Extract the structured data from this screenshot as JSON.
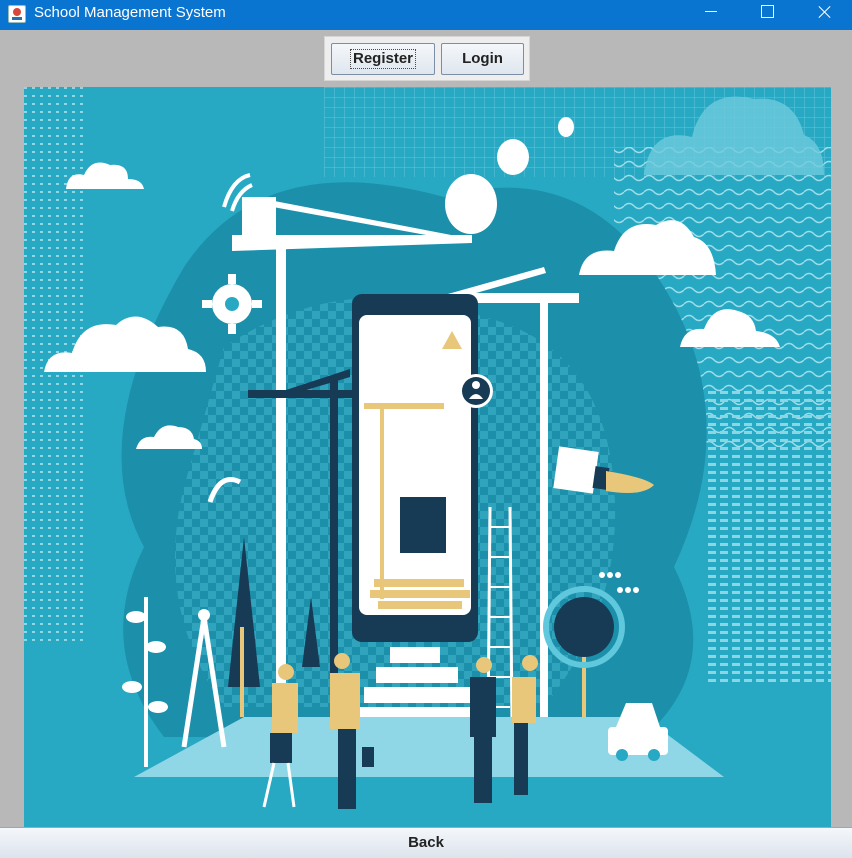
{
  "window": {
    "title": "School Management System",
    "controls": {
      "minimize": "minimize-icon",
      "maximize": "maximize-icon",
      "close": "close-icon"
    }
  },
  "toolbar": {
    "register_label": "Register",
    "login_label": "Login"
  },
  "main": {
    "illustration": "construction-site-illustration-with-phone-crane-and-people"
  },
  "footer": {
    "back_label": "Back"
  },
  "colors": {
    "titlebar": "#0a74d1",
    "illustration_bg": "#27a9c4",
    "window_bg": "#b8b8b8"
  }
}
